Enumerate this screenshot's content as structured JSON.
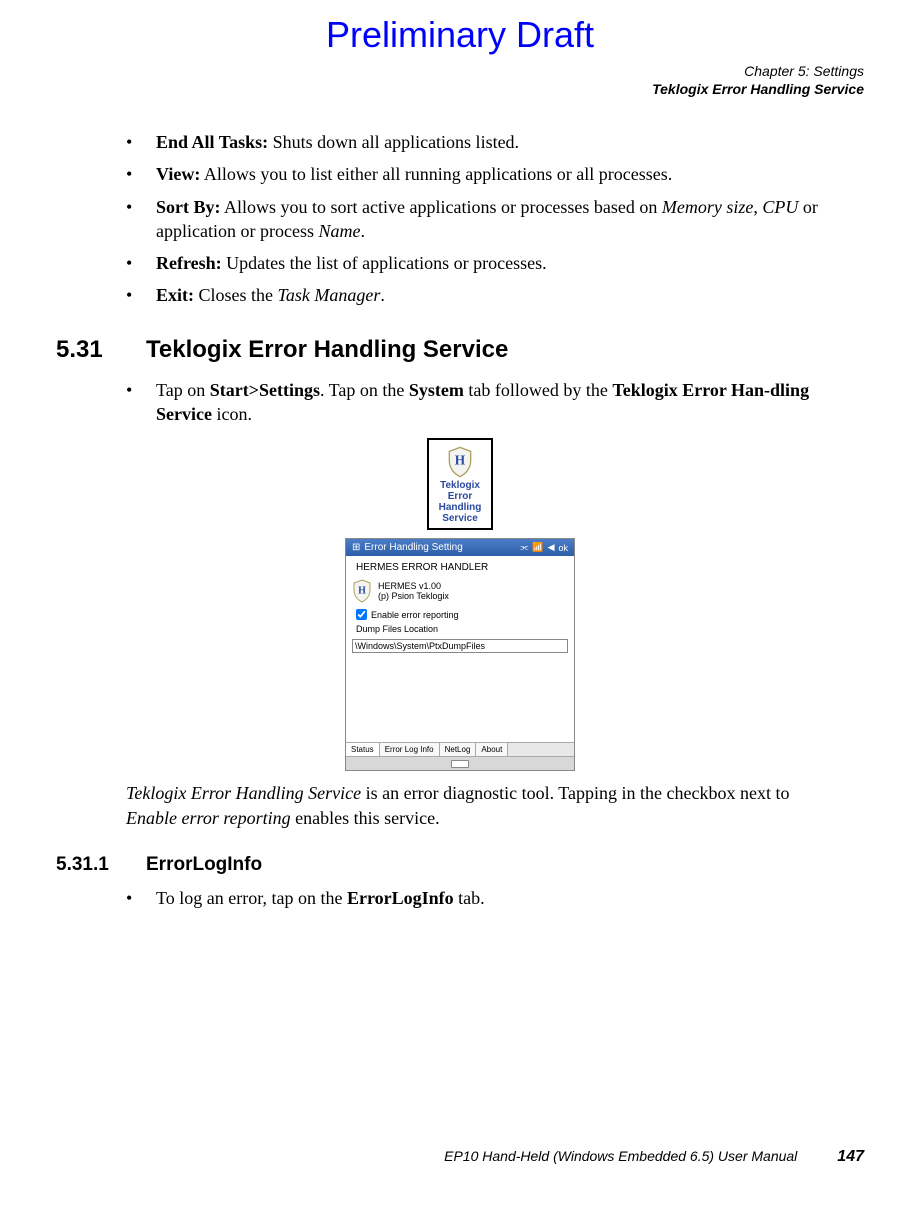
{
  "watermark": "Preliminary Draft",
  "header": {
    "chapter": "Chapter 5:  Settings",
    "section": "Teklogix Error Handling Service"
  },
  "bullets_top": [
    {
      "bold": "End All Tasks:",
      "rest": " Shuts down all applications listed."
    },
    {
      "bold": "View:",
      "rest": " Allows you to list either all running applications or all processes."
    },
    {
      "bold": "Sort By:",
      "rest_before": " Allows you to sort active applications or processes based on ",
      "italic1": "Memory size",
      "mid": ", ",
      "italic2": "CPU",
      "after": " or application or process ",
      "italic3": "Name",
      "end": "."
    },
    {
      "bold": "Refresh:",
      "rest": " Updates the list of applications or processes."
    },
    {
      "bold": "Exit:",
      "rest_before": " Closes the ",
      "italic1": "Task Manager",
      "end": "."
    }
  ],
  "section531": {
    "num": "5.31",
    "title": "Teklogix Error Handling Service",
    "bullet": {
      "pre": "Tap on ",
      "b1": "Start>Settings",
      "t1": ". Tap on the ",
      "b2": "System",
      "t2": " tab followed by the ",
      "b3": "Teklogix Error Han-dling Service",
      "t3": " icon."
    }
  },
  "icon": {
    "l1": "Teklogix",
    "l2": "Error",
    "l3": "Handling",
    "l4": "Service"
  },
  "screenshot": {
    "title": "Error Handling Setting",
    "ok": "ok",
    "handler": "HERMES ERROR HANDLER",
    "ver1": "HERMES v1.00",
    "ver2": "(p) Psion Teklogix",
    "chk_label": "Enable error reporting",
    "dump_label": "Dump Files Location",
    "dump_value": "\\Windows\\System\\PtxDumpFiles",
    "tabs": [
      "Status",
      "Error Log Info",
      "NetLog",
      "About"
    ]
  },
  "para_after": {
    "i1": "Teklogix Error Handling Service",
    "t1": " is an error diagnostic tool. Tapping in the checkbox next to ",
    "i2": "Enable error reporting",
    "t2": " enables this service."
  },
  "section5311": {
    "num": "5.31.1",
    "title": "ErrorLogInfo",
    "bullet": {
      "pre": "To log an error, tap on the ",
      "b1": "ErrorLogInfo",
      "t1": " tab."
    }
  },
  "footer": {
    "manual": "EP10 Hand-Held (Windows Embedded 6.5) User Manual",
    "page": "147"
  }
}
